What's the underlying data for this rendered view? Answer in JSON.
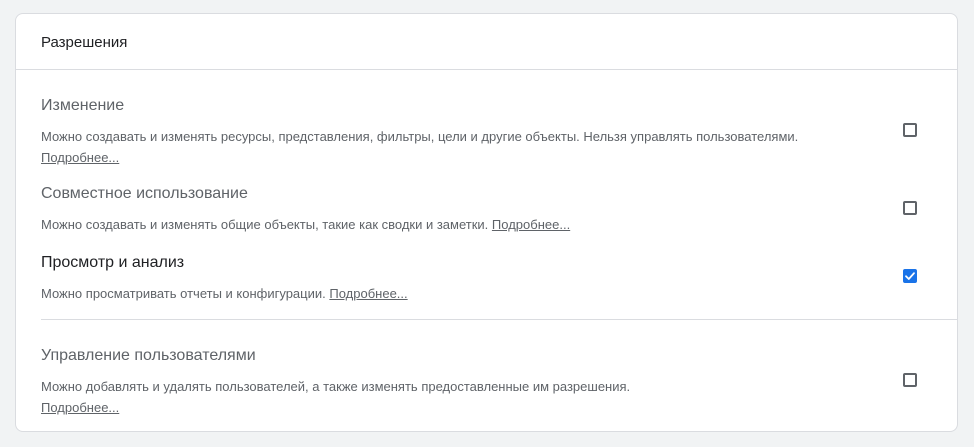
{
  "card": {
    "title": "Разрешения"
  },
  "permissions": [
    {
      "title": "Изменение",
      "description": "Можно создавать и изменять ресурсы, представления, фильтры, цели и другие объекты. Нельзя управлять пользователями.",
      "link": "Подробнее...",
      "checked": false
    },
    {
      "title": "Совместное использование",
      "description": "Можно создавать и изменять общие объекты, такие как сводки и заметки.",
      "link": "Подробнее...",
      "checked": false
    },
    {
      "title": "Просмотр и анализ",
      "description": "Можно просматривать отчеты и конфигурации.",
      "link": "Подробнее...",
      "checked": true
    },
    {
      "title": "Управление пользователями",
      "description": "Можно добавлять и удалять пользователей, а также изменять предоставленные им разрешения.",
      "link": "Подробнее...",
      "checked": false
    }
  ],
  "colors": {
    "accent": "#1a73e8",
    "text_primary": "#202124",
    "text_secondary": "#5f6368",
    "border": "#dadce0"
  }
}
